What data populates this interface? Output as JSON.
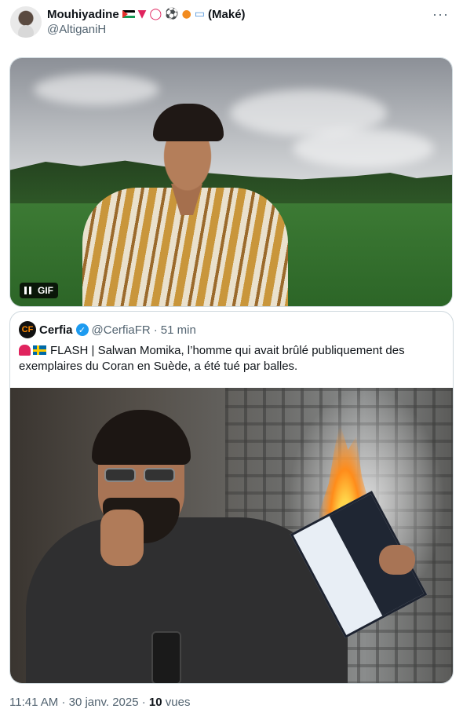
{
  "author": {
    "name": "Mouhiyadine",
    "name_suffix": "(Maké)",
    "handle": "@AltiganiH",
    "emojis": [
      "palestine-flag",
      "red-triangle",
      "red-circle",
      "soccer-ball",
      "basketball",
      "laptop"
    ]
  },
  "media": {
    "badge": "GIF"
  },
  "quote": {
    "name": "Cerfia",
    "avatar_text": "CF",
    "handle": "@CerfiaFR",
    "separator": "·",
    "time": "51 min",
    "text": "FLASH | Salwan Momika, l’homme qui avait brûlé publiquement des exemplaires du Coran en Suède, a été tué par balles."
  },
  "footer": {
    "time": "11:41 AM",
    "date": "30 janv. 2025",
    "views_count": "10",
    "views_label": "vues",
    "separator": "·"
  },
  "colors": {
    "muted": "#536471",
    "verified": "#1d9bf0",
    "border": "#cfd9de"
  }
}
